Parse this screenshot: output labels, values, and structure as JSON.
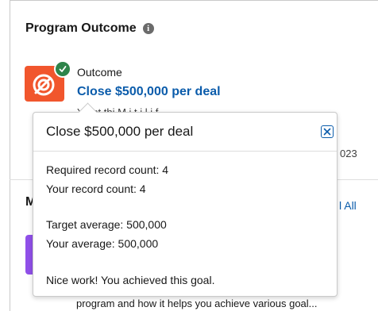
{
  "section": {
    "title": "Program Outcome",
    "info_icon": "info-icon",
    "second_section_letter": "M",
    "view_all": "l All"
  },
  "outcome": {
    "label": "Outcome",
    "name": "Close $500,000 per deal",
    "icon": "target-icon",
    "badge_icon": "check-icon",
    "icon_color": "#f1562d",
    "badge_color": "#2e844a"
  },
  "behind": {
    "partial_line": "Y      ant thi  M i t i                      l i  f",
    "partial_date": "023",
    "footer_line": "program and how it helps you achieve various goal..."
  },
  "popover": {
    "title": "Close $500,000 per deal",
    "close_icon": "close-icon",
    "required_count": "Required record count: 4",
    "your_count": "Your record count: 4",
    "target_avg": "Target average: 500,000",
    "your_avg": "Your average: 500,000",
    "message": "Nice work! You achieved this goal."
  },
  "colors": {
    "link": "#0b5cab",
    "purple_tile": "#9050e9"
  }
}
